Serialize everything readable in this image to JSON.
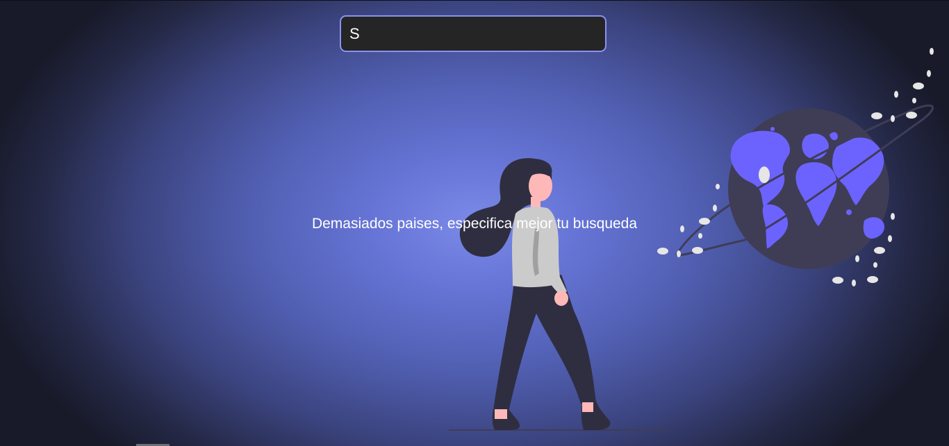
{
  "search": {
    "value": "S",
    "placeholder": ""
  },
  "status": {
    "message": "Demasiados paises, especifica mejor tu busqueda"
  },
  "illustration": {
    "globe_icon": "globe-icon",
    "person_icon": "woman-walking-illustration"
  },
  "colors": {
    "accent": "#6c63ff",
    "input_border": "#8b93f0",
    "input_background": "#252526",
    "text": "#ffffff",
    "background_center": "#7b8ae8",
    "background_edge": "#181a2a"
  }
}
